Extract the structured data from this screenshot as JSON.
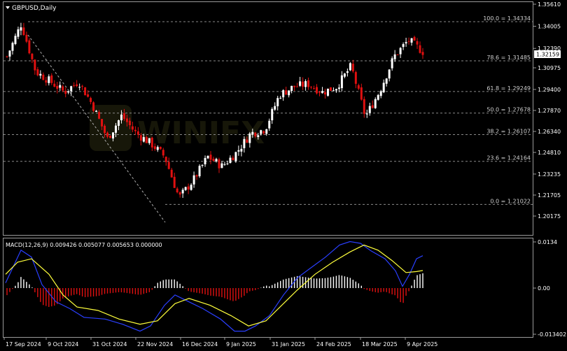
{
  "chart_title": "GBPUSD,Daily",
  "macd_label": "MACD(12,26,9) 0.009426 0.005077 0.005653 0.000000",
  "current_price": "1.32159",
  "colors": {
    "bull": "#ffffff",
    "bear": "#e01010",
    "grid": "#8a8a8a",
    "macd_main": "#2a3fff",
    "macd_signal": "#ffff3c",
    "hist_pos": "#ffffff",
    "hist_neg": "#e01010"
  },
  "chart_data": {
    "type": "candlestick",
    "title": "GBPUSD,Daily",
    "price_axis": {
      "ticks": [
        "1.35610",
        "1.34005",
        "1.32390",
        "1.30975",
        "1.29400",
        "1.27870",
        "1.26340",
        "1.24810",
        "1.23235",
        "1.21705",
        "1.20175"
      ],
      "ylim": [
        1.20175,
        1.3561
      ]
    },
    "x_ticks": [
      "17 Sep 2024",
      "9 Oct 2024",
      "31 Oct 2024",
      "22 Nov 2024",
      "16 Dec 2024",
      "9 Jan 2025",
      "31 Jan 2025",
      "24 Feb 2025",
      "18 Mar 2025",
      "9 Apr 2025"
    ],
    "fibonacci": [
      {
        "label": "100.0 = 1.34334",
        "value": 1.34334
      },
      {
        "label": "78.6 = 1.31485",
        "value": 1.31485
      },
      {
        "label": "61.8 = 1.29249",
        "value": 1.29249
      },
      {
        "label": "50.0 = 1.27678",
        "value": 1.27678
      },
      {
        "label": "38.2 = 1.26107",
        "value": 1.26107
      },
      {
        "label": "23.6 = 1.24164",
        "value": 1.24164
      },
      {
        "label": "0.0 = 1.21022",
        "value": 1.21022
      }
    ],
    "price_path": [
      {
        "date": "17 Sep 2024",
        "close": 1.318
      },
      {
        "date": "26 Sep 2024",
        "close": 1.342
      },
      {
        "date": "9 Oct 2024",
        "close": 1.307
      },
      {
        "date": "20 Oct 2024",
        "close": 1.3
      },
      {
        "date": "31 Oct 2024",
        "close": 1.292
      },
      {
        "date": "6 Nov 2024",
        "close": 1.3
      },
      {
        "date": "12 Nov 2024",
        "close": 1.282
      },
      {
        "date": "22 Nov 2024",
        "close": 1.258
      },
      {
        "date": "6 Dec 2024",
        "close": 1.275
      },
      {
        "date": "16 Dec 2024",
        "close": 1.262
      },
      {
        "date": "27 Dec 2024",
        "close": 1.255
      },
      {
        "date": "6 Jan 2025",
        "close": 1.245
      },
      {
        "date": "13 Jan 2025",
        "close": 1.215
      },
      {
        "date": "20 Jan 2025",
        "close": 1.228
      },
      {
        "date": "27 Jan 2025",
        "close": 1.245
      },
      {
        "date": "3 Feb 2025",
        "close": 1.238
      },
      {
        "date": "10 Feb 2025",
        "close": 1.248
      },
      {
        "date": "17 Feb 2025",
        "close": 1.262
      },
      {
        "date": "24 Feb 2025",
        "close": 1.265
      },
      {
        "date": "3 Mar 2025",
        "close": 1.29
      },
      {
        "date": "11 Mar 2025",
        "close": 1.296
      },
      {
        "date": "18 Mar 2025",
        "close": 1.298
      },
      {
        "date": "25 Mar 2025",
        "close": 1.292
      },
      {
        "date": "1 Apr 2025",
        "close": 1.296
      },
      {
        "date": "3 Apr 2025",
        "close": 1.311
      },
      {
        "date": "7 Apr 2025",
        "close": 1.274
      },
      {
        "date": "10 Apr 2025",
        "close": 1.293
      },
      {
        "date": "15 Apr 2025",
        "close": 1.318
      },
      {
        "date": "18 Apr 2025",
        "close": 1.33
      },
      {
        "date": "21 Apr 2025",
        "close": 1.32159
      }
    ],
    "macd": {
      "params": "12,26,9",
      "main": 0.009426,
      "signal": 0.005077,
      "histogram": 0.005653,
      "ticks": [
        "0.0134",
        "0.00",
        "-0.013402"
      ],
      "ylim": [
        -0.013402,
        0.0134
      ]
    }
  }
}
